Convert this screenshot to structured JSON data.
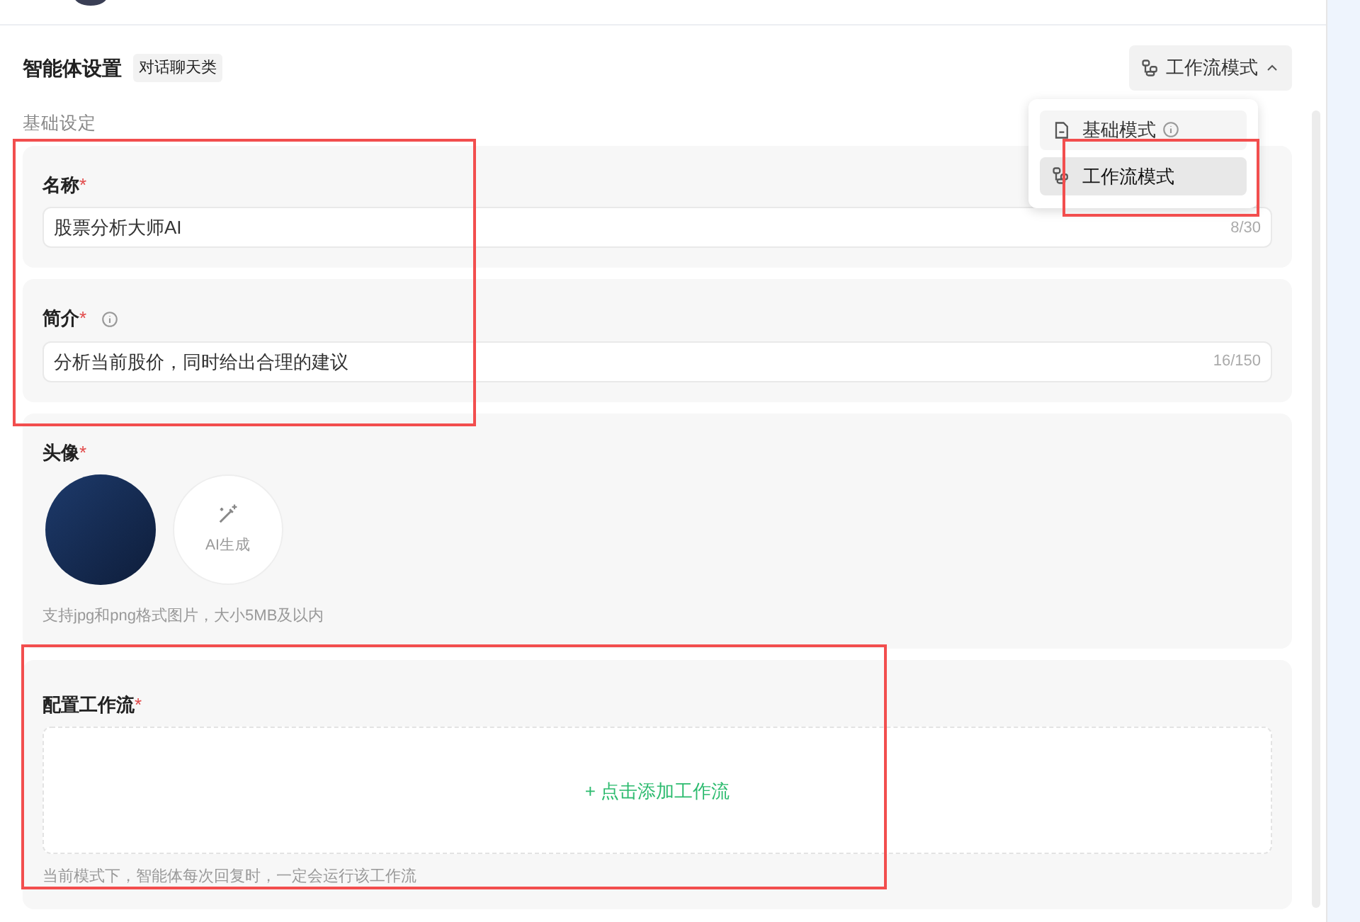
{
  "header": {
    "title": "智能体设置",
    "tag": "对话聊天类",
    "mode_button": {
      "label": "工作流模式",
      "expanded": true
    }
  },
  "mode_menu": [
    {
      "label": "基础模式",
      "kind": "document",
      "info": true,
      "selected": false
    },
    {
      "label": "工作流模式",
      "kind": "workflow",
      "info": false,
      "selected": true
    }
  ],
  "section_label": "基础设定",
  "fields": [
    {
      "label": "名称",
      "required": "*",
      "info": false,
      "value": "股票分析大师AI",
      "counter": "8/30"
    },
    {
      "label": "简介",
      "required": "*",
      "info": true,
      "value": "分析当前股价，同时给出合理的建议",
      "counter": "16/150"
    }
  ],
  "avatar": {
    "label": "头像",
    "required": "*",
    "generate_label": "AI生成",
    "hint": "支持jpg和png格式图片，大小5MB及以内"
  },
  "workflow": {
    "label": "配置工作流",
    "required": "*",
    "add_label": "+ 点击添加工作流",
    "hint": "当前模式下，智能体每次回复时，一定会运行该工作流"
  }
}
